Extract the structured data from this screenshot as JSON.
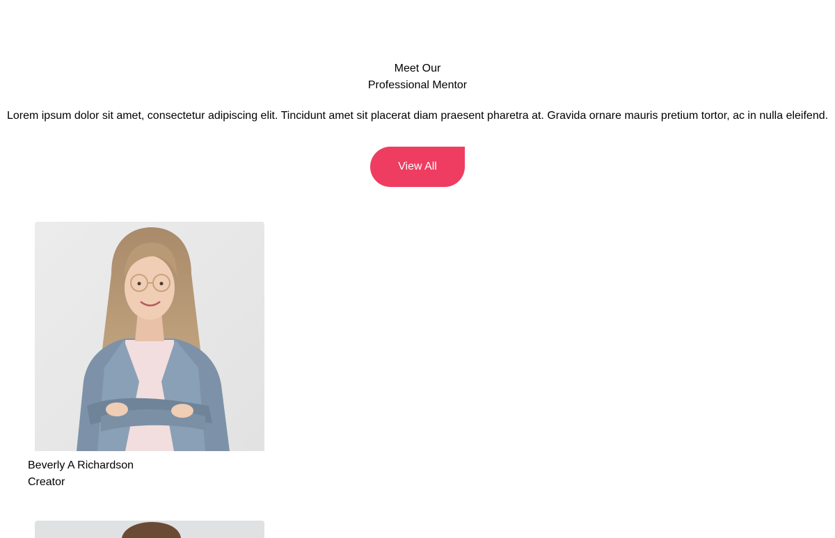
{
  "section": {
    "title_line1": "Meet Our",
    "title_line2": "Professional Mentor",
    "description": "Lorem ipsum dolor sit amet, consectetur adipiscing elit. Tincidunt amet sit placerat diam praesent pharetra at. Gravida ornare mauris pretium tortor, ac in nulla eleifend."
  },
  "view_all_button": {
    "label": "View All",
    "color": "#ee3d61",
    "text_color": "#ffffff"
  },
  "mentors": [
    {
      "name": "Beverly A Richardson",
      "role": "Creator",
      "photo": "woman-portrait-photo"
    },
    {
      "name": "",
      "role": "",
      "photo": "man-portrait-photo"
    }
  ]
}
